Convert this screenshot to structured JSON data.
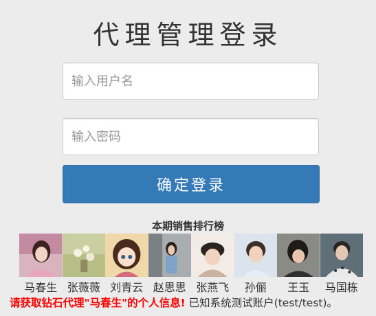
{
  "title": "代理管理登录",
  "form": {
    "username_placeholder": "输入用户名",
    "password_placeholder": "输入密码",
    "submit_label": "确定登录"
  },
  "ranking": {
    "title": "本期销售排行榜",
    "agents": [
      {
        "name": "马春生"
      },
      {
        "name": "张薇薇"
      },
      {
        "name": "刘青云"
      },
      {
        "name": "赵思思"
      },
      {
        "name": "张燕飞"
      },
      {
        "name": "孙俪"
      },
      {
        "name": "王玉"
      },
      {
        "name": "马国栋"
      }
    ]
  },
  "footer": {
    "promo": "请获取钻石代理\"马春生\"的个人信息!",
    "note": "已知系统测试账户(test/test)。"
  },
  "colors": {
    "primary": "#337ab7",
    "promo": "#ff0000",
    "background": "#ececec"
  }
}
